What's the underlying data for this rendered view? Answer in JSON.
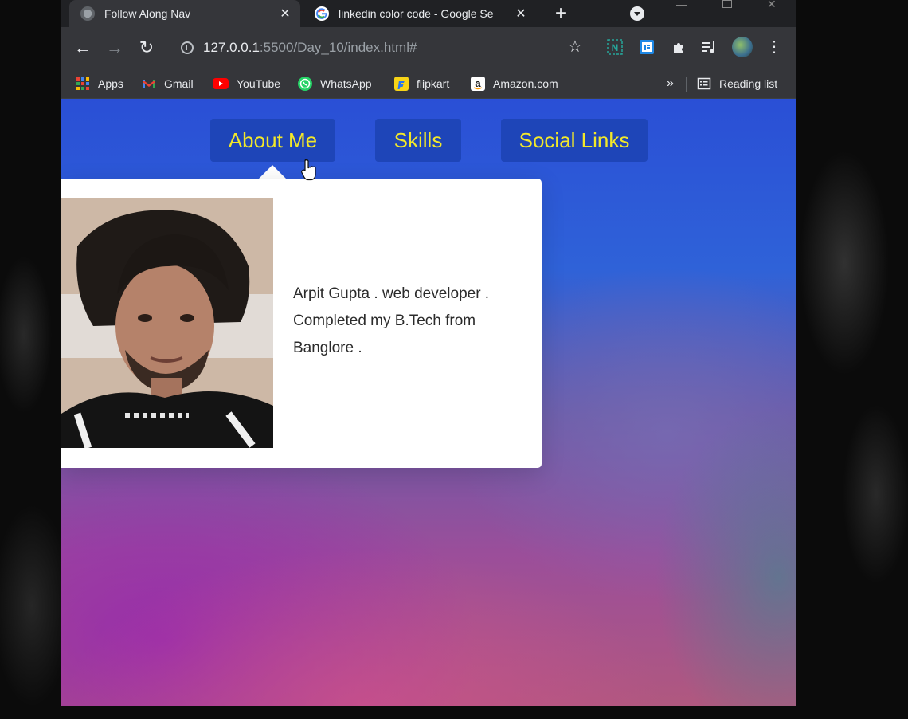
{
  "browser": {
    "tabs": [
      {
        "title": "Follow Along Nav",
        "active": true
      },
      {
        "title": "linkedin color code - Google Se",
        "active": false
      }
    ],
    "new_tab_label": "+",
    "address": {
      "host": "127.0.0.1",
      "path": ":5500/Day_10/index.html#"
    },
    "bookmarks": [
      "Apps",
      "Gmail",
      "YouTube",
      "WhatsApp",
      "flipkart",
      "Amazon.com"
    ],
    "overflow_label": "»",
    "reading_list": "Reading list"
  },
  "page": {
    "nav": [
      {
        "label": "About Me"
      },
      {
        "label": "Skills"
      },
      {
        "label": "Social Links"
      }
    ],
    "about": {
      "bio": "Arpit Gupta . web developer . Completed my B.Tech from Banglore ."
    }
  },
  "colors": {
    "nav_text": "#f2e82a",
    "nav_bg": "#1e45b8",
    "card_bg": "#ffffff"
  }
}
